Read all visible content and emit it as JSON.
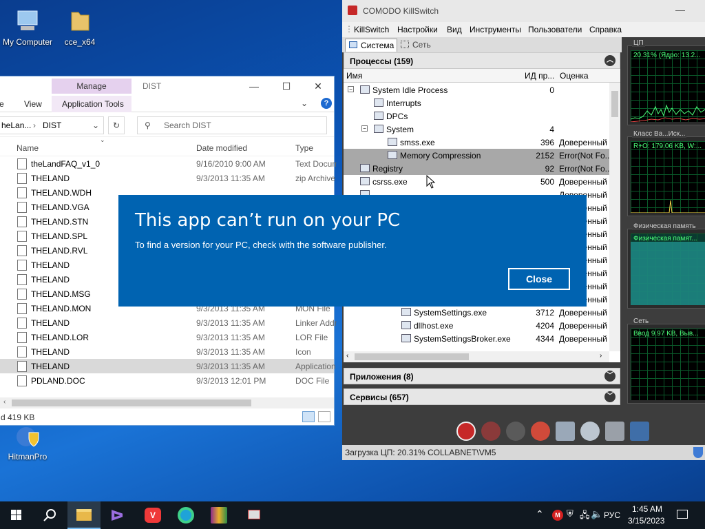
{
  "desktop": {
    "icons": [
      {
        "label": "My Computer",
        "icon": "computer-icon"
      },
      {
        "label": "cce_x64",
        "icon": "folder-icon"
      },
      {
        "label": "HitmanPro",
        "icon": "hitmanpro-icon"
      }
    ]
  },
  "explorer": {
    "manage_tab": "Manage",
    "title": "DIST",
    "ribbon": {
      "item_e": "e",
      "view": "View",
      "app_tools": "Application Tools"
    },
    "address": {
      "path_prefix": "heLan...",
      "path_folder": "DIST"
    },
    "search_placeholder": "Search DIST",
    "columns": {
      "name": "Name",
      "date": "Date modified",
      "type": "Type"
    },
    "files": [
      {
        "name": "theLandFAQ_v1_0",
        "date": "9/16/2010 9:00 AM",
        "type": "Text Docum"
      },
      {
        "name": "THELAND",
        "date": "9/3/2013 11:35 AM",
        "type": "zip Archive"
      },
      {
        "name": "THELAND.WDH",
        "date": "",
        "type": ""
      },
      {
        "name": "THELAND.VGA",
        "date": "",
        "type": ""
      },
      {
        "name": "THELAND.STN",
        "date": "",
        "type": ""
      },
      {
        "name": "THELAND.SPL",
        "date": "",
        "type": ""
      },
      {
        "name": "THELAND.RVL",
        "date": "",
        "type": ""
      },
      {
        "name": "THELAND",
        "date": "",
        "type": ""
      },
      {
        "name": "THELAND",
        "date": "",
        "type": ""
      },
      {
        "name": "THELAND.MSG",
        "date": "",
        "type": ""
      },
      {
        "name": "THELAND.MON",
        "date": "9/3/2013 11:35 AM",
        "type": "MON File"
      },
      {
        "name": "THELAND",
        "date": "9/3/2013 11:35 AM",
        "type": "Linker Addr"
      },
      {
        "name": "THELAND.LOR",
        "date": "9/3/2013 11:35 AM",
        "type": "LOR File"
      },
      {
        "name": "THELAND",
        "date": "9/3/2013 11:35 AM",
        "type": "Icon"
      },
      {
        "name": "THELAND",
        "date": "9/3/2013 11:35 AM",
        "type": "Application"
      },
      {
        "name": "PDLAND.DOC",
        "date": "9/3/2013 12:01 PM",
        "type": "DOC File"
      }
    ],
    "status_size": "d 419 KB"
  },
  "killswitch": {
    "title": "COMODO KillSwitch",
    "menu": [
      "KillSwitch",
      "Настройки",
      "Вид",
      "Инструменты",
      "Пользователи",
      "Справка"
    ],
    "tabs": [
      "Система",
      "Сеть"
    ],
    "processes_header": "Процессы (159)",
    "columns": {
      "name": "Имя",
      "pid": "ИД пр...",
      "rating": "Оценка"
    },
    "processes": [
      {
        "name": "System Idle Process",
        "pid": "0",
        "rating": ""
      },
      {
        "name": "Interrupts",
        "pid": "",
        "rating": ""
      },
      {
        "name": "DPCs",
        "pid": "",
        "rating": ""
      },
      {
        "name": "System",
        "pid": "4",
        "rating": ""
      },
      {
        "name": "smss.exe",
        "pid": "396",
        "rating": "Доверенный"
      },
      {
        "name": "Memory Compression",
        "pid": "2152",
        "rating": "Error(Not Fo..."
      },
      {
        "name": "Registry",
        "pid": "92",
        "rating": "Error(Not Fo..."
      },
      {
        "name": "csrss.exe",
        "pid": "500",
        "rating": "Доверенный"
      },
      {
        "name": "",
        "pid": "",
        "rating": "Доверенный"
      },
      {
        "name": "",
        "pid": "",
        "rating": "Доверенный"
      },
      {
        "name": "",
        "pid": "",
        "rating": "Доверенный"
      },
      {
        "name": "",
        "pid": "",
        "rating": "Доверенный"
      },
      {
        "name": "",
        "pid": "",
        "rating": "Доверенный"
      },
      {
        "name": "",
        "pid": "",
        "rating": "Доверенный"
      },
      {
        "name": "",
        "pid": "",
        "rating": "Доверенный"
      },
      {
        "name": "",
        "pid": "",
        "rating": "Доверенный"
      },
      {
        "name": "",
        "pid": "",
        "rating": "Доверенный"
      },
      {
        "name": "SystemSettings.exe",
        "pid": "3712",
        "rating": "Доверенный"
      },
      {
        "name": "dllhost.exe",
        "pid": "4204",
        "rating": "Доверенный"
      },
      {
        "name": "SystemSettingsBroker.exe",
        "pid": "4344",
        "rating": "Доверенный"
      }
    ],
    "apps_header": "Приложения (8)",
    "services_header": "Сервисы (657)",
    "graphs": [
      {
        "label": "ЦП",
        "text": "20.31% (Ядро: 13.2..."
      },
      {
        "label": "Класс Ва...Иск...",
        "text": "R+O: 179.06 KB, W:..."
      },
      {
        "label": "Физическая память",
        "text": "Физическая памят..."
      },
      {
        "label": "Сеть",
        "text": "Ввод 9.97 KB, Выв..."
      }
    ],
    "status": {
      "cpu": "Загрузка ЦП: 20.31%",
      "user": "COLLABNET\\VM5"
    }
  },
  "dialog": {
    "title": "This app can’t run on your PC",
    "message": "To find a version for your PC, check with the software publisher.",
    "close_label": "Close"
  },
  "taskbar": {
    "apps": [
      "file-explorer-icon",
      "visual-studio-icon",
      "vivaldi-icon",
      "edge-icon",
      "winrar-icon",
      "killswitch-icon"
    ],
    "lang": "РУС",
    "time": "1:45 AM",
    "date": "3/15/2023"
  },
  "colors": {
    "dialog_bg": "#0063b1",
    "taskbar_bg": "#101820",
    "graph_line": "#4dff7a",
    "manage_tab": "#e5d1ee"
  }
}
